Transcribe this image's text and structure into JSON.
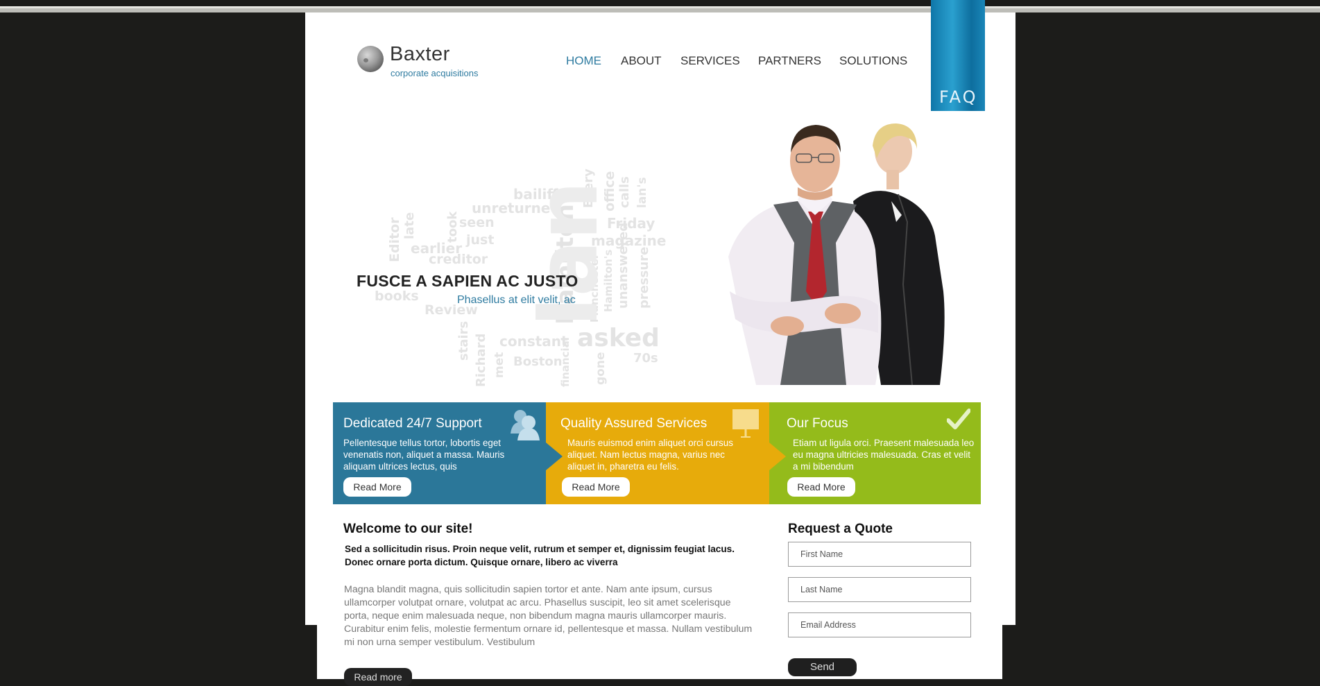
{
  "brand": {
    "name": "Baxter",
    "tagline": "corporate acquisitions"
  },
  "nav": {
    "items": [
      "HOME",
      "ABOUT",
      "SERVICES",
      "PARTNERS",
      "SOLUTIONS"
    ],
    "active": "HOME",
    "faq_label": "FAQ"
  },
  "hero": {
    "title": "FUSCE A SAPIEN AC JUSTO",
    "subtitle": "Phasellus at elit velit, ac",
    "word_cloud": [
      "bailiff",
      "unreturned",
      "seen",
      "just",
      "earlier",
      "creditor",
      "took",
      "late",
      "Editor",
      "Friday",
      "magazine",
      "office",
      "Every",
      "calls",
      "lan's",
      "Hamilton",
      "Review",
      "constant",
      "asked",
      "70s",
      "Boston",
      "stairs",
      "Richard",
      "met",
      "gone",
      "unanswered",
      "pressure",
      "Manchester",
      "financial",
      "books",
      "Hamilton's",
      "Ian"
    ]
  },
  "features": [
    {
      "title": "Dedicated 24/7 Support",
      "text": "Pellentesque tellus tortor, lobortis eget venenatis non, aliquet a massa. Mauris aliquam ultrices lectus, quis",
      "button": "Read More",
      "icon": "users-icon",
      "color": "#2b7799"
    },
    {
      "title": "Quality Assured Services",
      "text": "Mauris euismod enim aliquet orci cursus aliquet. Nam lectus magna, varius nec aliquet in, pharetra eu felis.",
      "button": "Read More",
      "icon": "presentation-board-icon",
      "color": "#e7ab0b"
    },
    {
      "title": "Our Focus",
      "text": "Etiam ut ligula orci. Praesent malesuada leo eu magna ultricies malesuada. Cras et velit a mi bibendum",
      "button": "Read More",
      "icon": "checkmark-icon",
      "color": "#94bb1b"
    }
  ],
  "welcome": {
    "title": "Welcome to our site!",
    "lead": "Sed a sollicitudin risus. Proin neque velit, rutrum et semper et, dignissim feugiat lacus. Donec ornare porta dictum. Quisque ornare, libero ac viverra",
    "body": "Magna blandit magna, quis sollicitudin sapien tortor et ante. Nam ante ipsum, cursus ullamcorper volutpat ornare, volutpat ac arcu. Phasellus suscipit, leo sit amet scelerisque porta, neque enim malesuada neque, non bibendum magna mauris ullamcorper mauris. Curabitur enim felis, molestie fermentum ornare id, pellentesque et massa. Nullam vestibulum mi non urna semper vestibulum. Vestibulum",
    "button": "Read more"
  },
  "quote": {
    "title": "Request a Quote",
    "first_name_placeholder": "First Name",
    "last_name_placeholder": "Last Name",
    "email_placeholder": "Email Address",
    "send_label": "Send"
  }
}
